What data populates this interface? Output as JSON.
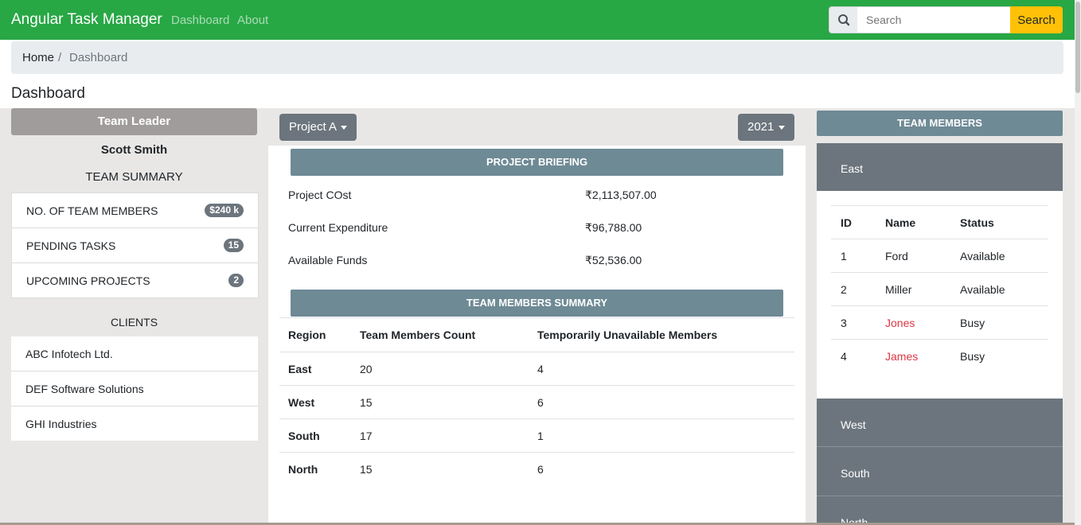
{
  "navbar": {
    "brand": "Angular Task Manager",
    "links": [
      "Dashboard",
      "About"
    ],
    "search_placeholder": "Search",
    "search_button": "Search",
    "color": "#28a745"
  },
  "breadcrumb": {
    "home": "Home",
    "separator": "/",
    "current": "Dashboard"
  },
  "page_title": "Dashboard",
  "left": {
    "header": "Team Leader",
    "leader_name": "Scott Smith",
    "team_summary_title": "TEAM SUMMARY",
    "summary": [
      {
        "label": "NO. OF TEAM MEMBERS",
        "badge": "$240 k"
      },
      {
        "label": "PENDING TASKS",
        "badge": "15"
      },
      {
        "label": "UPCOMING PROJECTS",
        "badge": "2"
      }
    ],
    "clients_title": "CLIENTS",
    "clients": [
      "ABC Infotech Ltd.",
      "DEF Software Solutions",
      "GHI Industries"
    ]
  },
  "middle": {
    "project_dropdown": "Project A",
    "year_dropdown": "2021",
    "briefing_title": "PROJECT BRIEFING",
    "briefing": [
      {
        "label": "Project COst",
        "value": "₹2,113,507.00"
      },
      {
        "label": "Current Expenditure",
        "value": "₹96,788.00"
      },
      {
        "label": "Available Funds",
        "value": "₹52,536.00"
      }
    ],
    "summary_title": "TEAM MEMBERS SUMMARY",
    "summary_headers": [
      "Region",
      "Team Members Count",
      "Temporarily Unavailable Members"
    ],
    "summary_rows": [
      {
        "region": "East",
        "count": "20",
        "unavailable": "4"
      },
      {
        "region": "West",
        "count": "15",
        "unavailable": "6"
      },
      {
        "region": "South",
        "count": "17",
        "unavailable": "1"
      },
      {
        "region": "North",
        "count": "15",
        "unavailable": "6"
      }
    ]
  },
  "right": {
    "header": "TEAM MEMBERS",
    "regions": [
      "East",
      "West",
      "South",
      "North"
    ],
    "member_headers": [
      "ID",
      "Name",
      "Status"
    ],
    "members": [
      {
        "id": "1",
        "name": "Ford",
        "status": "Available"
      },
      {
        "id": "2",
        "name": "Miller",
        "status": "Available"
      },
      {
        "id": "3",
        "name": "Jones",
        "status": "Busy"
      },
      {
        "id": "4",
        "name": "James",
        "status": "Busy"
      }
    ],
    "busy_color": "#dc3545"
  }
}
